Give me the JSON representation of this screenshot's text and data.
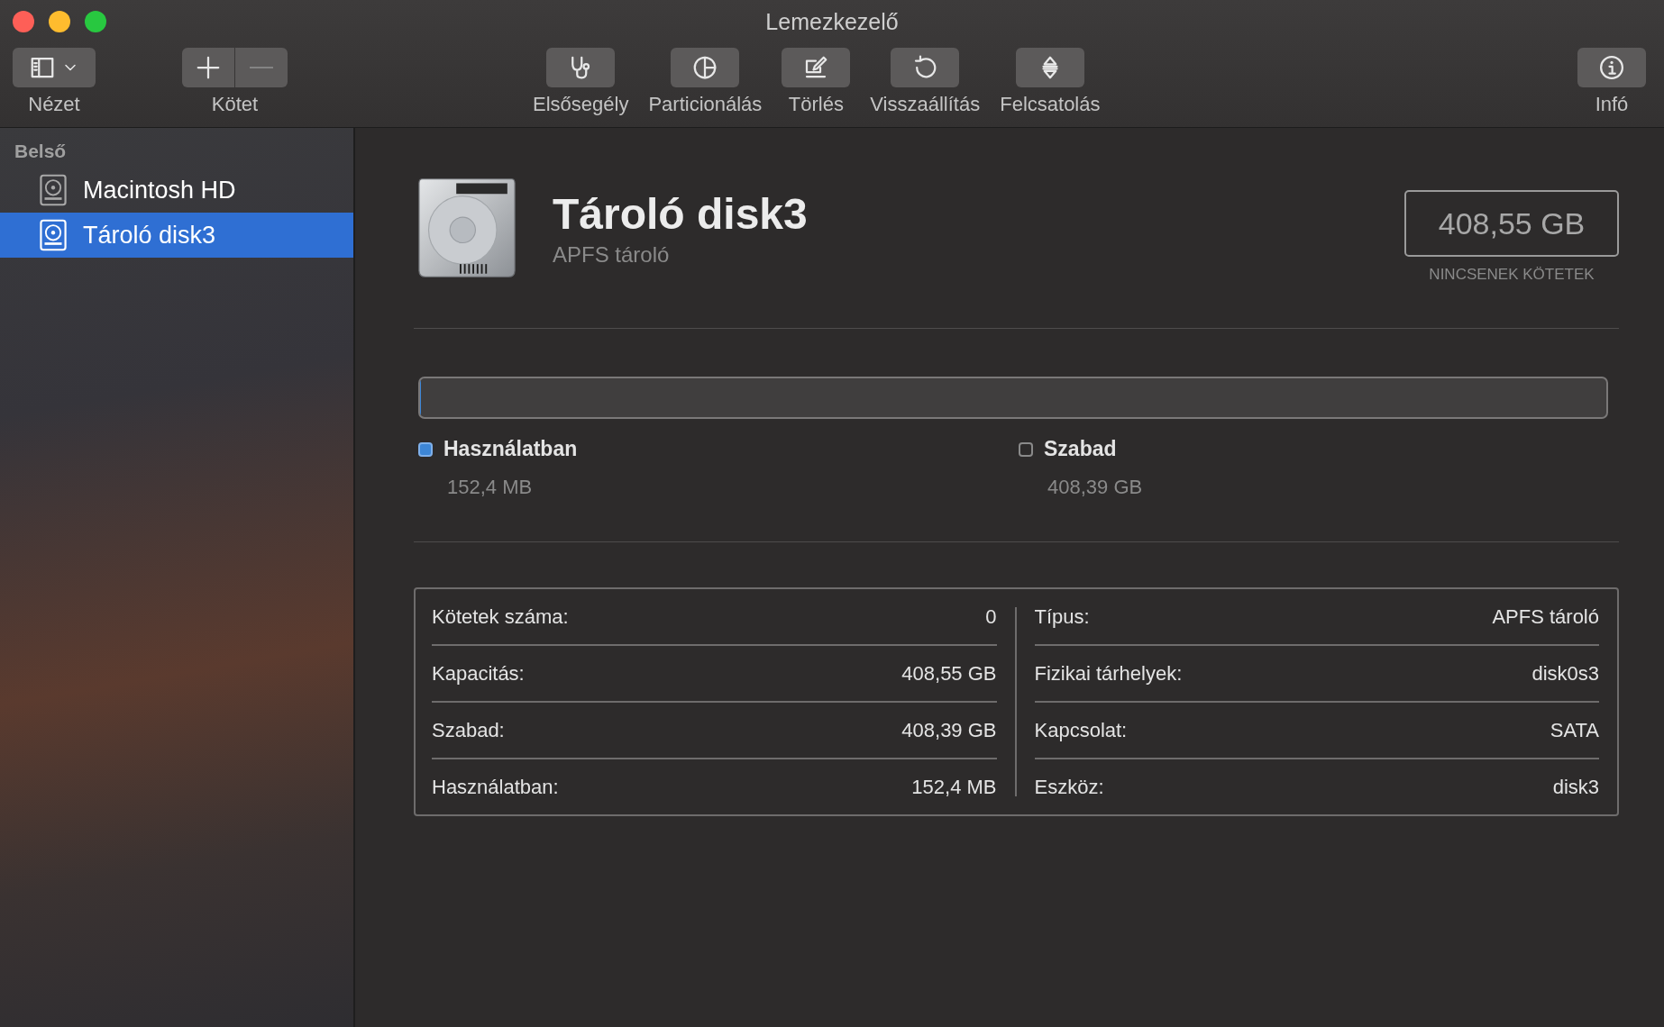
{
  "window": {
    "title": "Lemezkezelő"
  },
  "toolbar": {
    "left": [
      {
        "label": "Nézet",
        "kind": "view"
      },
      {
        "label": "Kötet",
        "kind": "plusminus"
      }
    ],
    "center": [
      {
        "label": "Elsősegély",
        "kind": "stethoscope"
      },
      {
        "label": "Particionálás",
        "kind": "pie"
      },
      {
        "label": "Törlés",
        "kind": "erase"
      },
      {
        "label": "Visszaállítás",
        "kind": "restore"
      },
      {
        "label": "Felcsatolás",
        "kind": "mount"
      }
    ],
    "right": [
      {
        "label": "Infó",
        "kind": "info"
      }
    ]
  },
  "sidebar": {
    "section": "Belső",
    "items": [
      {
        "label": "Macintosh HD",
        "selected": false
      },
      {
        "label": "Tároló disk3",
        "selected": true
      }
    ]
  },
  "header": {
    "title": "Tároló disk3",
    "subtitle": "APFS tároló",
    "capacity": "408,55 GB",
    "capacity_caption": "NINCSENEK KÖTETEK"
  },
  "usage": {
    "level": 0.0004,
    "legend": [
      {
        "label": "Használatban",
        "value": "152,4 MB",
        "color": "#3d86d6"
      },
      {
        "label": "Szabad",
        "value": "408,39 GB",
        "color": "#8a8a8a"
      }
    ]
  },
  "info": {
    "left": [
      {
        "label": "Kötetek száma:",
        "value": "0"
      },
      {
        "label": "Kapacitás:",
        "value": "408,55 GB"
      },
      {
        "label": "Szabad:",
        "value": "408,39 GB"
      },
      {
        "label": "Használatban:",
        "value": "152,4 MB"
      }
    ],
    "right": [
      {
        "label": "Típus:",
        "value": "APFS tároló"
      },
      {
        "label": "Fizikai tárhelyek:",
        "value": "disk0s3"
      },
      {
        "label": "Kapcsolat:",
        "value": "SATA"
      },
      {
        "label": "Eszköz:",
        "value": "disk3"
      }
    ]
  }
}
